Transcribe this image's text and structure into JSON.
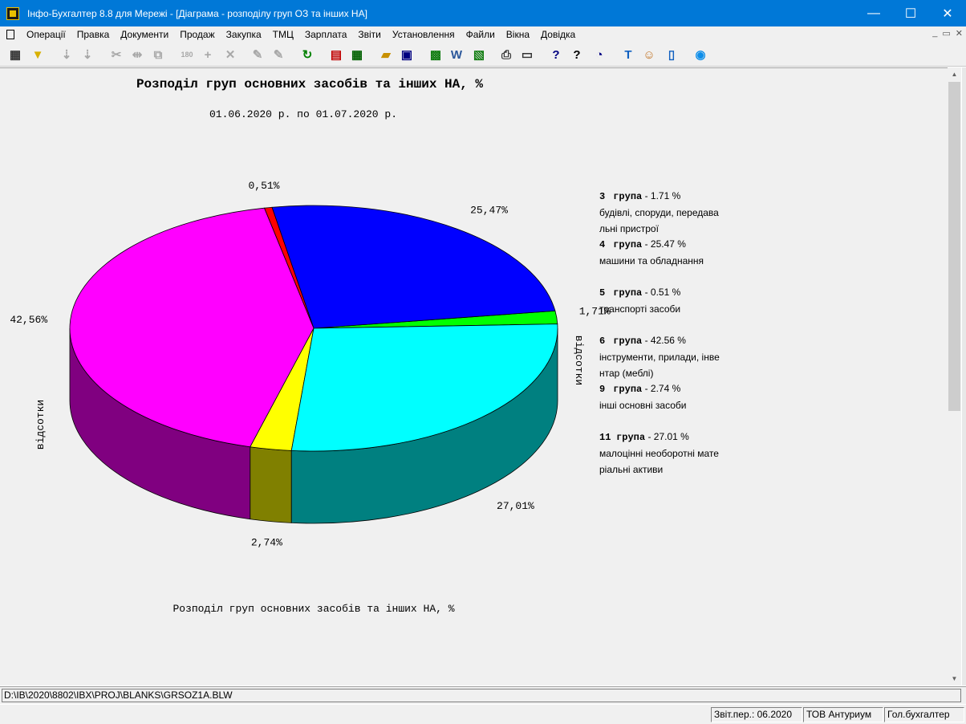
{
  "window": {
    "title": "Інфо-Бухгалтер 8.8 для Мережі - [Діаграма - розподілу груп ОЗ та інших НА]",
    "minimize": "—",
    "maximize": "☐",
    "close": "✕"
  },
  "menu": {
    "items": [
      "Операції",
      "Правка",
      "Документи",
      "Продаж",
      "Закупка",
      "ТМЦ",
      "Зарплата",
      "Звіти",
      "Установлення",
      "Файли",
      "Вікна",
      "Довідка"
    ],
    "mdi_minimize": "_",
    "mdi_restore": "▭",
    "mdi_close": "✕"
  },
  "toolbar": {
    "icons": [
      "table-grid-icon",
      "filter-icon",
      "sort-asc-icon",
      "sort-desc-icon",
      "cut-icon",
      "columns-icon",
      "copy-icon",
      "rotate-180-icon",
      "add-icon",
      "delete-icon",
      "edit-icon",
      "rename-icon",
      "refresh-icon",
      "pdf-icon",
      "calculator-icon",
      "open-folder-icon",
      "save-icon",
      "excel-icon",
      "word-icon",
      "export-icon",
      "print-icon",
      "preview-icon",
      "help-icon",
      "context-help-icon",
      "compass-icon",
      "text-icon",
      "users-icon",
      "report-icon",
      "teamviewer-icon"
    ]
  },
  "chart": {
    "title": "Розподіл груп основних засобів та інших НА, %",
    "period": "01.06.2020 р. по 01.07.2020 р.",
    "caption": "Розподіл груп основних засобів та інших НА, %",
    "axis_label_left": "відсотки",
    "axis_label_right": "відсотки"
  },
  "chart_data": {
    "type": "pie",
    "title": "Розподіл груп основних засобів та інших НА, %",
    "subtitle": "01.06.2020 р. по 01.07.2020 р.",
    "slices": [
      {
        "group": "3",
        "name": "будівлі, споруди, передавальні пристрої",
        "value": 1.71,
        "label": "1,71%",
        "color": "#00ff00",
        "side": "#008000"
      },
      {
        "group": "4",
        "name": "машини та обладнання",
        "value": 25.47,
        "label": "25,47%",
        "color": "#0000ff",
        "side": "#000080"
      },
      {
        "group": "5",
        "name": "транспорті засоби",
        "value": 0.51,
        "label": "0,51%",
        "color": "#ff0000",
        "side": "#800000"
      },
      {
        "group": "6",
        "name": "інструменти, прилади, інвентар (меблі)",
        "value": 42.56,
        "label": "42,56%",
        "color": "#ff00ff",
        "side": "#800080"
      },
      {
        "group": "9",
        "name": "інші основні засоби",
        "value": 2.74,
        "label": "2,74%",
        "color": "#ffff00",
        "side": "#808000"
      },
      {
        "group": "11",
        "name": "малоцінні необоротні матеріальні активи",
        "value": 27.01,
        "label": "27,01%",
        "color": "#00ffff",
        "side": "#008080"
      }
    ],
    "legend_placement": "right"
  },
  "legend": [
    {
      "group": "3",
      "word": "група",
      "value_text": "- 1.71 %",
      "desc": "будівлі, споруди, передавальні пристрої"
    },
    {
      "group": "4",
      "word": "група",
      "value_text": "- 25.47 %",
      "desc": "машини та обладнання"
    },
    {
      "group": "5",
      "word": "група",
      "value_text": "- 0.51 %",
      "desc": "транспорті засоби"
    },
    {
      "group": "6",
      "word": "група",
      "value_text": "- 42.56 %",
      "desc": "інструменти, прилади, інвентар (меблі)"
    },
    {
      "group": "9",
      "word": "група",
      "value_text": "- 2.74 %",
      "desc": "інші основні засоби"
    },
    {
      "group": "11",
      "word": "група",
      "value_text": "- 27.01 %",
      "desc": "малоцінні необоротні матеріальні активи"
    }
  ],
  "path": "D:\\IB\\2020\\8802\\IBX\\PROJ\\BLANKS\\GRSOZ1A.BLW",
  "status": {
    "period": "Звіт.пер.: 06.2020",
    "company": "ТОВ Антуриум",
    "role": "Гол.бухгалтер"
  }
}
